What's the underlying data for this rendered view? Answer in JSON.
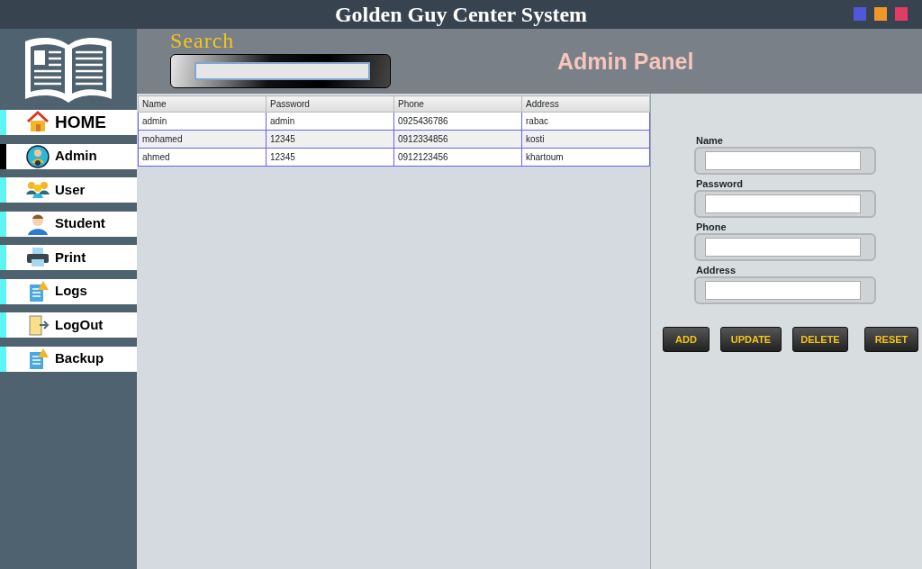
{
  "window": {
    "title": "Golden Guy Center System",
    "controls": [
      {
        "color": "#5057d8"
      },
      {
        "color": "#f0962a"
      },
      {
        "color": "#e23c64"
      }
    ]
  },
  "sidebar": {
    "items": [
      {
        "label": "HOME",
        "selected": false
      },
      {
        "label": "Admin",
        "selected": true
      },
      {
        "label": "User",
        "selected": false
      },
      {
        "label": "Student",
        "selected": false
      },
      {
        "label": "Print",
        "selected": false
      },
      {
        "label": "Logs",
        "selected": false
      },
      {
        "label": "LogOut",
        "selected": false
      },
      {
        "label": "Backup",
        "selected": false
      }
    ]
  },
  "search": {
    "label": "Search"
  },
  "header": {
    "title": "Admin Panel"
  },
  "table": {
    "columns": [
      "Name",
      "Password",
      "Phone",
      "Address"
    ],
    "rows": [
      [
        "admin",
        "admin",
        "0925436786",
        "rabac"
      ],
      [
        "mohamed",
        "12345",
        "0912334856",
        "kosti"
      ],
      [
        "ahmed",
        "12345",
        "0912123456",
        "khartoum"
      ]
    ]
  },
  "form": {
    "fields": [
      {
        "label": "Name"
      },
      {
        "label": "Password"
      },
      {
        "label": "Phone"
      },
      {
        "label": "Address"
      }
    ],
    "buttons": [
      "ADD",
      "UPDATE",
      "DELETE",
      "RESET"
    ]
  }
}
